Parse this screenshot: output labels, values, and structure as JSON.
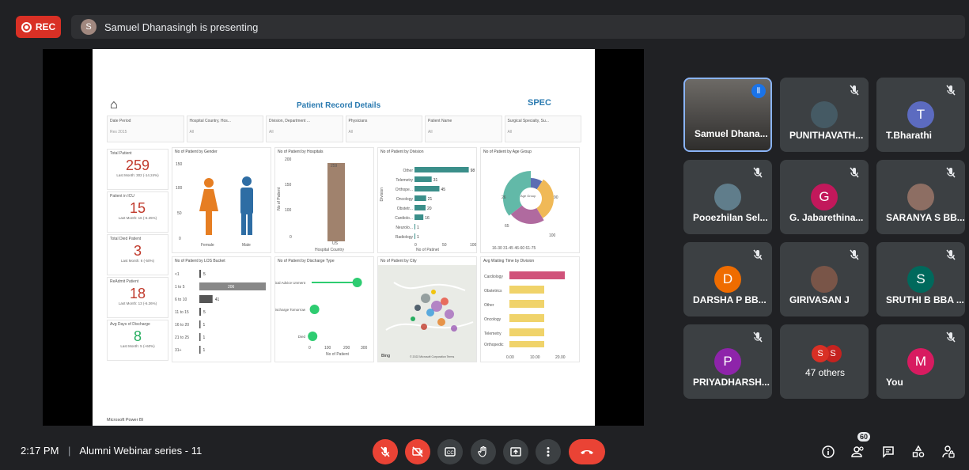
{
  "rec": {
    "label": "REC"
  },
  "presenter_banner": {
    "avatar_letter": "S",
    "text": "Samuel Dhanasingh is presenting"
  },
  "dashboard": {
    "title": "Patient Record Details",
    "logo": "SPEC",
    "filters": [
      {
        "label": "Date Period",
        "value": "Res 2015"
      },
      {
        "label": "Hospital Country, Hos...",
        "value": "All"
      },
      {
        "label": "Division, Department ...",
        "value": "All"
      },
      {
        "label": "Physicians",
        "value": "All"
      },
      {
        "label": "Patient Name",
        "value": "All"
      },
      {
        "label": "Surgical Specialty, Su...",
        "value": "All"
      }
    ],
    "kpis": [
      {
        "label": "Total Patient",
        "value": "259",
        "sub": "Last Month: 302 (-14.24%)"
      },
      {
        "label": "Patient in ICU",
        "value": "15",
        "sub": "Last Month: 16 (-6.25%)"
      },
      {
        "label": "Total Died Patient",
        "value": "3",
        "sub": "Last Month: 6 (-50%)"
      },
      {
        "label": "ReAdmit Patient",
        "value": "18",
        "sub": "Last Month: 13 (-6.26%)"
      },
      {
        "label": "Avg Days of Discharge",
        "value": "8",
        "sub": "Last Month: 5 (+60%)"
      }
    ],
    "gender_chart": {
      "title": "No of Patient by Gender",
      "female": "Female",
      "male": "Male",
      "y_ticks": [
        "150",
        "100",
        "50",
        "0"
      ]
    },
    "hospital_chart": {
      "title": "No of Patient by Hospitals",
      "bar_label": "259",
      "ylabel": "No of Patient",
      "xlabel": "Hospital Country",
      "x_tick": "US",
      "y_ticks": [
        "200",
        "150",
        "100",
        "0"
      ]
    },
    "division_chart": {
      "title": "No of Patient by Division",
      "ylabel": "Division",
      "xlabel": "No of Patinet",
      "x_ticks": [
        "0",
        "50",
        "100"
      ]
    },
    "age_chart": {
      "title": "No of Patient by Age Group",
      "center": "Age Group",
      "labels": [
        "26",
        "90",
        "65",
        "100"
      ],
      "legend": "16-30 31-45 46-60 61-75"
    },
    "los_chart": {
      "title": "No of Patient by LOS Bucket"
    },
    "discharge_chart": {
      "title": "No of Patient by Discharge Type",
      "xlabel": "No of Patient",
      "x_ticks": [
        "0",
        "100",
        "200",
        "300"
      ]
    },
    "city_chart": {
      "title": "No of Patient by City",
      "bing": "Bing",
      "copyright": "© 2022 Microsoft Corporation  Terms"
    },
    "wait_chart": {
      "title": "Avg Waiting Time by Division",
      "x_ticks": [
        "0.00",
        "10.00",
        "20.00"
      ]
    },
    "footer": "Microsoft Power BI"
  },
  "chart_data": [
    {
      "type": "bar",
      "title": "No of Patient by Division",
      "ylabel": "Division",
      "xlabel": "No of Patinet",
      "categories": [
        "Other",
        "Telemetry",
        "Orthope...",
        "Oncology",
        "Obstetr...",
        "Cardiolo...",
        "Neurolo...",
        "Radiology"
      ],
      "values": [
        98,
        31,
        45,
        21,
        20,
        16,
        1,
        1
      ],
      "xlim": [
        0,
        100
      ]
    },
    {
      "type": "bar",
      "title": "No of Patient by LOS Bucket",
      "categories": [
        "<1",
        "1 to 5",
        "6 to 10",
        "11 to 15",
        "16 to 20",
        "21 to 25",
        "31+"
      ],
      "values": [
        5,
        206,
        41,
        5,
        1,
        1,
        1
      ]
    },
    {
      "type": "scatter",
      "title": "No of Patient by Discharge Type",
      "xlabel": "No of Patient",
      "categories": [
        "Clinical Advice Unment",
        "Discharge Tomorrow",
        "Died"
      ],
      "values": [
        240,
        15,
        5
      ],
      "xlim": [
        0,
        300
      ]
    },
    {
      "type": "bar",
      "title": "No of Patient by Hospitals",
      "categories": [
        "US"
      ],
      "values": [
        259
      ],
      "ylim": [
        0,
        250
      ]
    },
    {
      "type": "pie",
      "title": "No of Patient by Age Group",
      "categories": [
        "16-30",
        "31-45",
        "46-60",
        "61-75"
      ],
      "values": [
        26,
        90,
        65,
        100
      ]
    }
  ],
  "division_labels": [
    "Other",
    "Telemetry",
    "Orthope...",
    "Oncology",
    "Obstetr...",
    "Cardiolo...",
    "Neurolo...",
    "Radiology"
  ],
  "division_values": [
    "98",
    "31",
    "45",
    "21",
    "20",
    "16",
    "1",
    "1"
  ],
  "los_labels": [
    "<1",
    "1 to 5",
    "6 to 10",
    "11 to 15",
    "16 to 20",
    "21 to 25",
    "31+"
  ],
  "los_values": [
    "5",
    "206",
    "41",
    "5",
    "1",
    "1",
    "1"
  ],
  "discharge_labels": [
    "Clinical Advice Unment",
    "Discharge Tomorrow",
    "Died"
  ],
  "wait_labels": [
    "Cardiology",
    "Obstetrics",
    "Other",
    "Oncology",
    "Telemetry",
    "Orthopedic"
  ],
  "participants": [
    {
      "name": "Samuel Dhana...",
      "letter": "",
      "color": "#5f6368",
      "speaking": true
    },
    {
      "name": "PUNITHAVATH...",
      "letter": "",
      "color": "#455a64"
    },
    {
      "name": "T.Bharathi",
      "letter": "T",
      "color": "#5c6bc0"
    },
    {
      "name": "Pooezhilan Sel...",
      "letter": "",
      "color": "#607d8b"
    },
    {
      "name": "G. Jabarethina...",
      "letter": "G",
      "color": "#c2185b"
    },
    {
      "name": "SARANYA S BB...",
      "letter": "",
      "color": "#8d6e63"
    },
    {
      "name": "DARSHA P BB...",
      "letter": "D",
      "color": "#ef6c00"
    },
    {
      "name": "GIRIVASAN J",
      "letter": "",
      "color": "#795548"
    },
    {
      "name": "SRUTHI B BBA ...",
      "letter": "S",
      "color": "#00695c"
    },
    {
      "name": "PRIYADHARSH...",
      "letter": "P",
      "color": "#8e24aa"
    },
    {
      "name": "47 others",
      "letter": "S",
      "color": "#d93025"
    },
    {
      "name": "You",
      "letter": "M",
      "color": "#d81b60"
    }
  ],
  "bottom_bar": {
    "time": "2:17 PM",
    "separator": "|",
    "meeting": "Alumni Webinar series - 11",
    "people_count": "60"
  }
}
